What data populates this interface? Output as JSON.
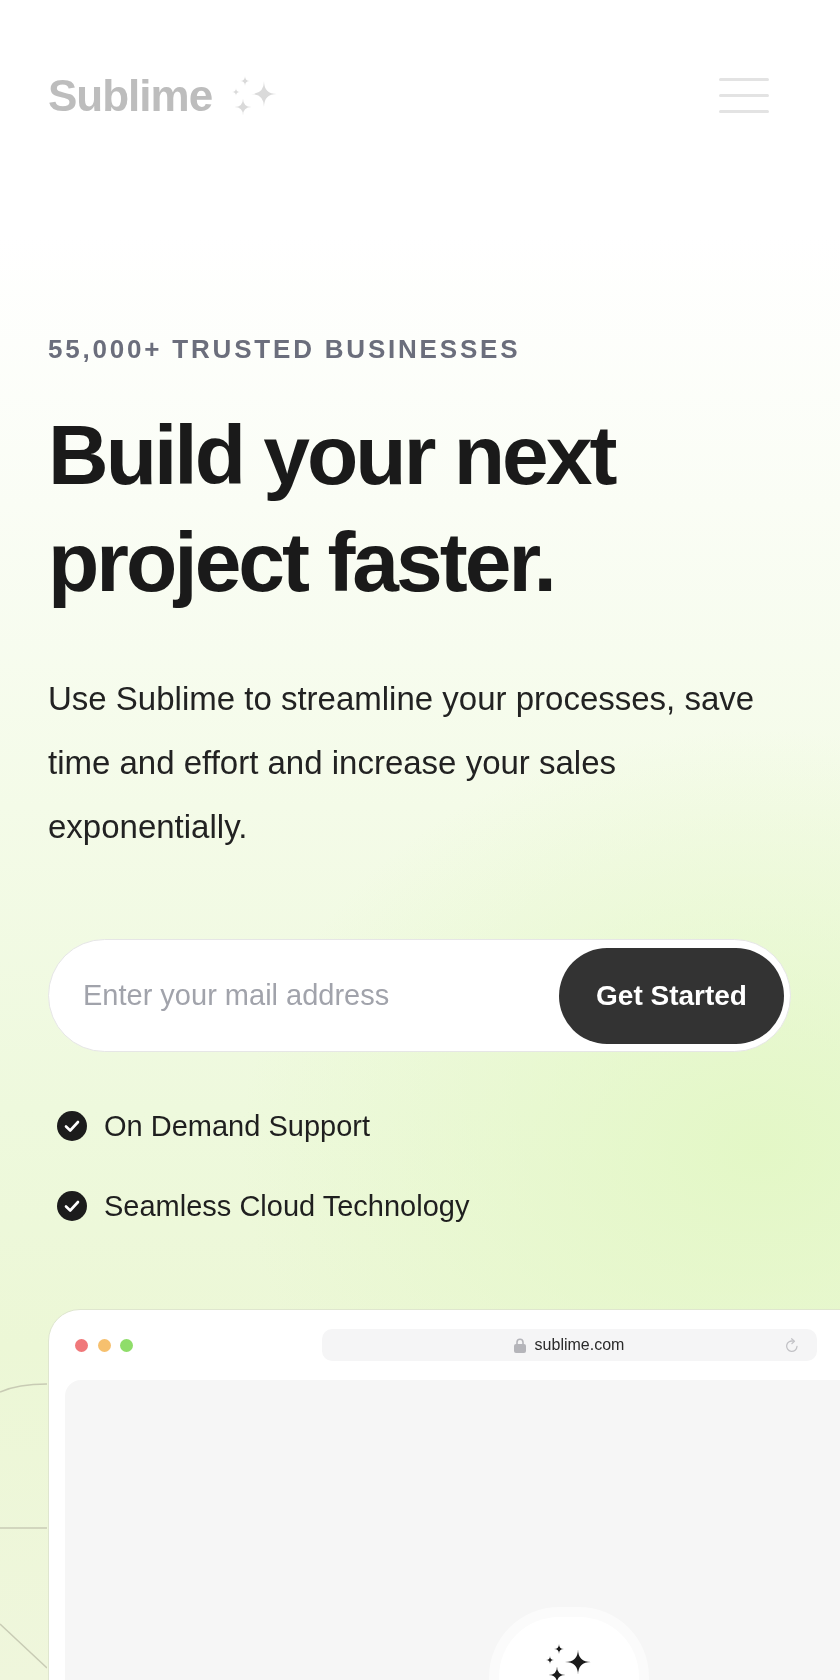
{
  "header": {
    "logo": "Sublime"
  },
  "hero": {
    "eyebrow": "55,000+ TRUSTED BUSINESSES",
    "title": "Build your next project faster.",
    "description": "Use Sublime to streamline your processes, save time and effort and increase your sales exponentially."
  },
  "signup": {
    "placeholder": "Enter your mail address",
    "button": "Get Started"
  },
  "features": [
    "On Demand Support",
    "Seamless Cloud Technology"
  ],
  "browser_preview": {
    "url": "sublime.com"
  }
}
